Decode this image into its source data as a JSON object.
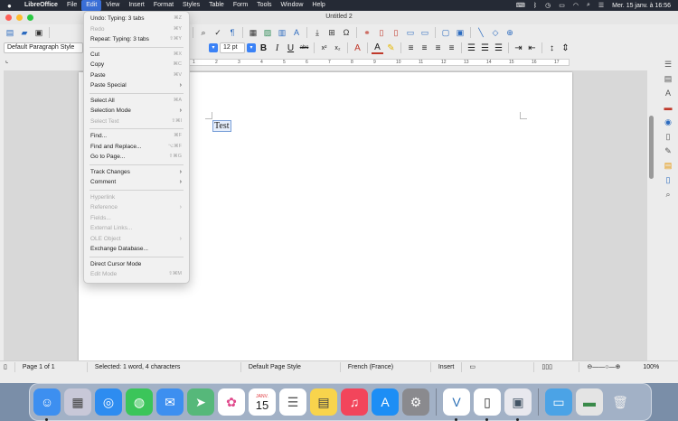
{
  "menubar": {
    "app": "LibreOffice",
    "items": [
      "File",
      "Edit",
      "View",
      "Insert",
      "Format",
      "Styles",
      "Table",
      "Form",
      "Tools",
      "Window",
      "Help"
    ],
    "clock": "Mer. 15 janv. à 16:56"
  },
  "window": {
    "title": "Untitled 2"
  },
  "toolbar": {
    "paragraph_style": "Default Paragraph Style",
    "font_size": "12 pt"
  },
  "ruler": {
    "marks": [
      "1",
      "2",
      "3",
      "4",
      "5",
      "6",
      "7",
      "8",
      "9",
      "10",
      "11",
      "12",
      "13",
      "14",
      "15",
      "16",
      "17",
      "18"
    ]
  },
  "document": {
    "text": "Test"
  },
  "edit_menu": {
    "items": [
      {
        "label": "Undo: Typing: 3 tabs",
        "shortcut": "⌘Z",
        "enabled": true
      },
      {
        "label": "Redo",
        "shortcut": "⌘Y",
        "enabled": false
      },
      {
        "label": "Repeat: Typing: 3 tabs",
        "shortcut": "⇧⌘Y",
        "enabled": true
      },
      {
        "sep": true
      },
      {
        "label": "Cut",
        "shortcut": "⌘X",
        "enabled": true
      },
      {
        "label": "Copy",
        "shortcut": "⌘C",
        "enabled": true
      },
      {
        "label": "Paste",
        "shortcut": "⌘V",
        "enabled": true
      },
      {
        "label": "Paste Special",
        "submenu": true,
        "enabled": true
      },
      {
        "sep": true
      },
      {
        "label": "Select All",
        "shortcut": "⌘A",
        "enabled": true
      },
      {
        "label": "Selection Mode",
        "submenu": true,
        "enabled": true
      },
      {
        "label": "Select Text",
        "shortcut": "⇧⌘I",
        "enabled": false
      },
      {
        "sep": true
      },
      {
        "label": "Find...",
        "shortcut": "⌘F",
        "enabled": true
      },
      {
        "label": "Find and Replace...",
        "shortcut": "⌥⌘F",
        "enabled": true
      },
      {
        "label": "Go to Page...",
        "shortcut": "⇧⌘G",
        "enabled": true
      },
      {
        "sep": true
      },
      {
        "label": "Track Changes",
        "submenu": true,
        "enabled": true
      },
      {
        "label": "Comment",
        "submenu": true,
        "enabled": true
      },
      {
        "sep": true
      },
      {
        "label": "Hyperlink",
        "enabled": false
      },
      {
        "label": "Reference",
        "submenu": true,
        "enabled": false
      },
      {
        "label": "Fields...",
        "enabled": false
      },
      {
        "label": "External Links...",
        "enabled": false
      },
      {
        "label": "OLE Object",
        "submenu": true,
        "enabled": false
      },
      {
        "label": "Exchange Database...",
        "enabled": true
      },
      {
        "sep": true
      },
      {
        "label": "Direct Cursor Mode",
        "enabled": true
      },
      {
        "label": "Edit Mode",
        "shortcut": "⇧⌘M",
        "enabled": false
      }
    ]
  },
  "statusbar": {
    "page": "Page 1 of 1",
    "selection": "Selected: 1 word, 4 characters",
    "page_style": "Default Page Style",
    "language": "French (France)",
    "insert_mode": "Insert",
    "zoom": "100%"
  },
  "dock": {
    "calendar_month": "JANV.",
    "calendar_day": "15",
    "apps": [
      "finder",
      "launchpad",
      "safari",
      "messages",
      "mail",
      "maps",
      "photos",
      "calendar",
      "reminders",
      "notes",
      "music",
      "app-store",
      "system-preferences",
      "veracrypt",
      "libreoffice-writer",
      "preview",
      "downloads-folder",
      "pasteboard",
      "trash"
    ]
  }
}
